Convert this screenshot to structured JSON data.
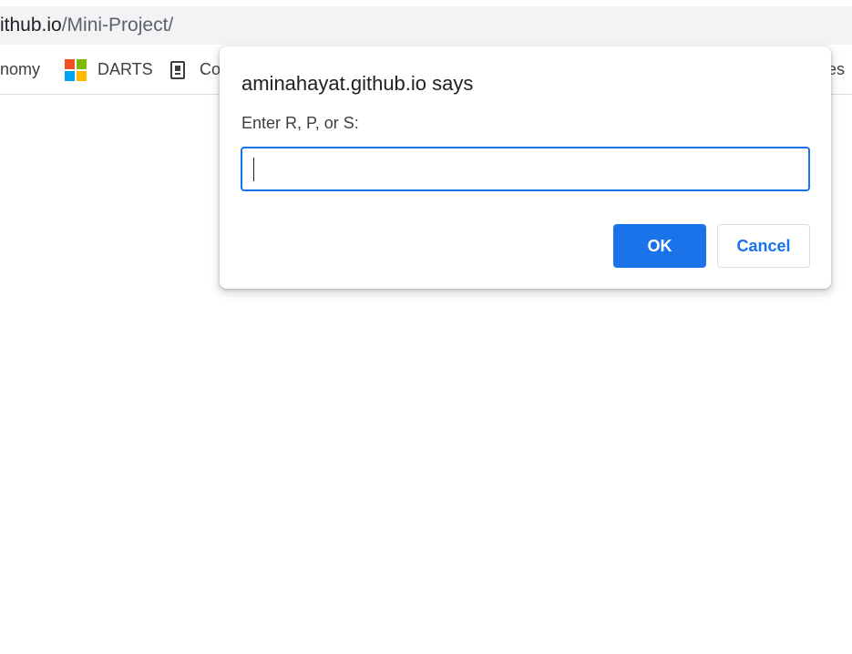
{
  "browser": {
    "address": {
      "host": "ithub.io",
      "path": "/Mini-Project/"
    },
    "bookmarks": [
      {
        "label": "nomy",
        "icon": "none"
      },
      {
        "label": "DARTS",
        "icon": "microsoft-logo-icon"
      },
      {
        "label": "Co",
        "icon": "document-icon"
      },
      {
        "label": "iles",
        "icon": "none"
      }
    ]
  },
  "dialog": {
    "title": "aminahayat.github.io says",
    "message": "Enter R, P, or S:",
    "input": {
      "value": "",
      "placeholder": ""
    },
    "ok_label": "OK",
    "cancel_label": "Cancel"
  },
  "colors": {
    "accent": "#1a73e8",
    "address_bar_bg": "#f1f3f4",
    "text_primary": "#202124"
  }
}
